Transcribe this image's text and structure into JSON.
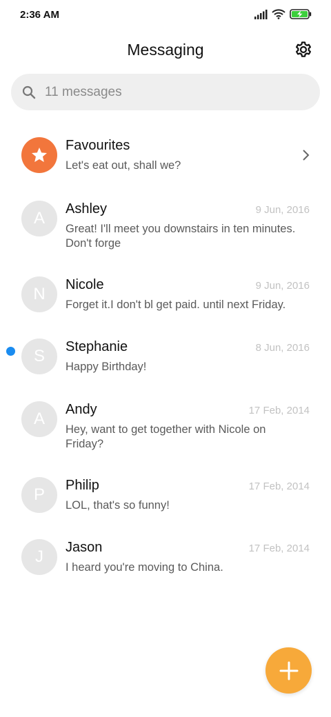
{
  "status_bar": {
    "time": "2:36 AM",
    "icons": [
      "signal-icon",
      "wifi-icon",
      "battery-charging-icon"
    ]
  },
  "header": {
    "title": "Messaging",
    "settings_icon": "gear-icon"
  },
  "search": {
    "placeholder": "11 messages",
    "icon": "search-icon"
  },
  "favourites": {
    "name": "Favourites",
    "snippet": "Let's eat out, shall we?",
    "icon": "star-icon",
    "color": "#f2763c"
  },
  "threads": [
    {
      "initial": "A",
      "name": "Ashley",
      "date": "9 Jun, 2016",
      "snippet": "Great! I'll meet you downstairs in ten minutes. Don't forge",
      "unread": false
    },
    {
      "initial": "N",
      "name": "Nicole",
      "date": "9 Jun, 2016",
      "snippet": "Forget it.I don't bl get paid. until next Friday.",
      "unread": false
    },
    {
      "initial": "S",
      "name": "Stephanie",
      "date": "8 Jun, 2016",
      "snippet": "Happy Birthday!",
      "unread": true
    },
    {
      "initial": "A",
      "name": "Andy",
      "date": "17 Feb, 2014",
      "snippet": "Hey, want to get together with Nicole on Friday?",
      "unread": false
    },
    {
      "initial": "P",
      "name": "Philip",
      "date": "17 Feb, 2014",
      "snippet": "LOL, that's so funny!",
      "unread": false
    },
    {
      "initial": "J",
      "name": "Jason",
      "date": "17 Feb, 2014",
      "snippet": "I heard you're moving to China.",
      "unread": false
    }
  ],
  "fab": {
    "icon": "plus-icon",
    "color": "#f7a93a"
  },
  "colors": {
    "unread_dot": "#1a8cf0",
    "avatar_bg": "#e6e6e6",
    "search_bg": "#efefef",
    "battery": "#3ccf3c"
  }
}
